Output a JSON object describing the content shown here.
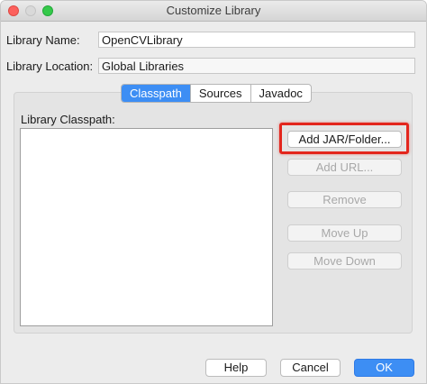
{
  "window": {
    "title": "Customize Library"
  },
  "form": {
    "library_name_label": "Library Name:",
    "library_name_value": "OpenCVLibrary",
    "library_location_label": "Library Location:",
    "library_location_value": "Global Libraries"
  },
  "tabs": [
    {
      "label": "Classpath",
      "active": true
    },
    {
      "label": "Sources",
      "active": false
    },
    {
      "label": "Javadoc",
      "active": false
    }
  ],
  "classpath": {
    "label": "Library Classpath:",
    "items": []
  },
  "side_buttons": {
    "add_jar": "Add JAR/Folder...",
    "add_url": "Add URL...",
    "remove": "Remove",
    "move_up": "Move Up",
    "move_down": "Move Down"
  },
  "footer": {
    "help": "Help",
    "cancel": "Cancel",
    "ok": "OK"
  },
  "colors": {
    "accent": "#3d8ef4",
    "highlight": "#e3261d"
  }
}
